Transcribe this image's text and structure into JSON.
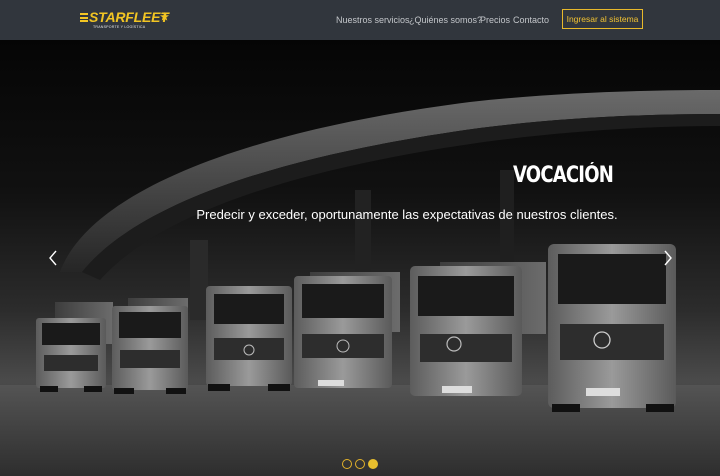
{
  "brand": {
    "name": "STARFLEET",
    "tagline": "TRANSPORTE Y LOGÍSTICA",
    "accent_color": "#f2c523"
  },
  "nav": {
    "links": [
      {
        "label": "Nuestros servicios"
      },
      {
        "label": "¿Quiénes somos?"
      },
      {
        "label": "Precios"
      },
      {
        "label": "Contacto"
      }
    ],
    "login_label": "Ingresar al sistema"
  },
  "carousel": {
    "title": "VOCACIÓN",
    "caption": "Predecir y exceder, oportunamente las expectativas de nuestros clientes.",
    "prev_icon": "chevron-left-icon",
    "next_icon": "chevron-right-icon",
    "slide_count": 3,
    "active_slide": 3,
    "plates": [
      "",
      "",
      "",
      "",
      "",
      ""
    ]
  }
}
